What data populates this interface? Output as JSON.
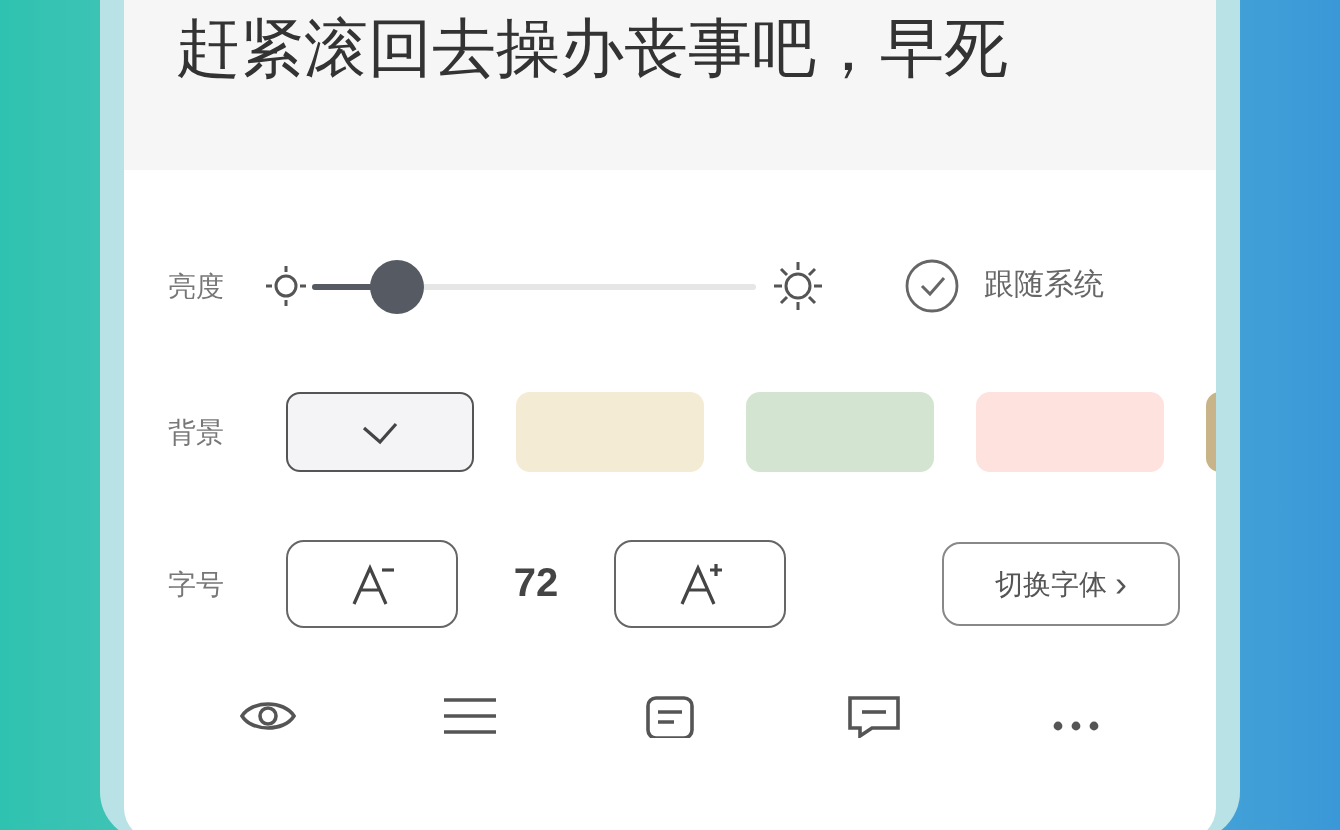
{
  "reading_text": [
    "赶紧滚回去操办丧事吧，早死"
  ],
  "brightness": {
    "label": "亮度",
    "level": 0.15,
    "follow_system": {
      "label": "跟随系统",
      "checked": true
    }
  },
  "background": {
    "label": "背景",
    "swatches": [
      {
        "color": "#f4f4f6",
        "selected": true
      },
      {
        "color": "#f3ebd3",
        "selected": false
      },
      {
        "color": "#d3e5d0",
        "selected": false
      },
      {
        "color": "#fde2de",
        "selected": false
      },
      {
        "color": "#c9b48a",
        "selected": false
      }
    ]
  },
  "font_size": {
    "label": "字号",
    "value": "72",
    "switch_font": "切换字体",
    "chevron": "›"
  },
  "toolbar": [
    {
      "kind": "eye"
    },
    {
      "kind": "list"
    },
    {
      "kind": "note"
    },
    {
      "kind": "comment"
    },
    {
      "kind": "more"
    }
  ]
}
